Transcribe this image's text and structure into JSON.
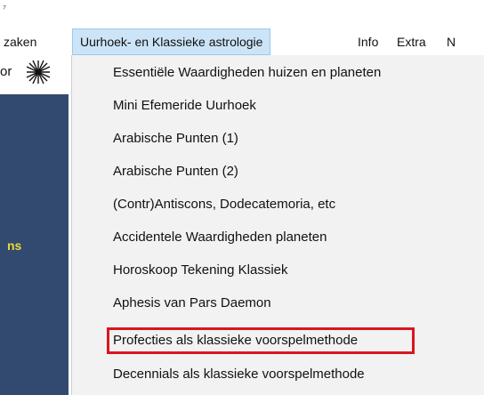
{
  "menubar": {
    "items": [
      {
        "label": "zaken"
      },
      {
        "label": "Uurhoek- en Klassieke astrologie"
      },
      {
        "label": "Info"
      },
      {
        "label": "Extra"
      },
      {
        "label": "N"
      }
    ]
  },
  "toolbar": {
    "label": "or"
  },
  "left_panel": {
    "text": "ns"
  },
  "dropdown": {
    "items": [
      {
        "label": "Essentiële Waardigheden huizen en planeten"
      },
      {
        "label": "Mini Efemeride Uurhoek"
      },
      {
        "label": "Arabische Punten (1)"
      },
      {
        "label": "Arabische Punten (2)"
      },
      {
        "label": "(Contr)Antiscons, Dodecatemoria, etc"
      },
      {
        "label": "Accidentele Waardigheden planeten"
      },
      {
        "label": "Horoskoop Tekening Klassiek"
      },
      {
        "label": "Aphesis van Pars Daemon"
      },
      {
        "label": "Profecties als klassieke voorspelmethode"
      },
      {
        "label": "Decennials als klassieke voorspelmethode"
      }
    ],
    "highlighted_index": 8
  },
  "colors": {
    "menu_active_bg": "#cce4f7",
    "dropdown_bg": "#f2f2f2",
    "panel_bg": "#324a6f",
    "panel_text": "#e8d83a",
    "highlight_border": "#d9161e"
  },
  "icons": [
    "sunburst-icon"
  ]
}
